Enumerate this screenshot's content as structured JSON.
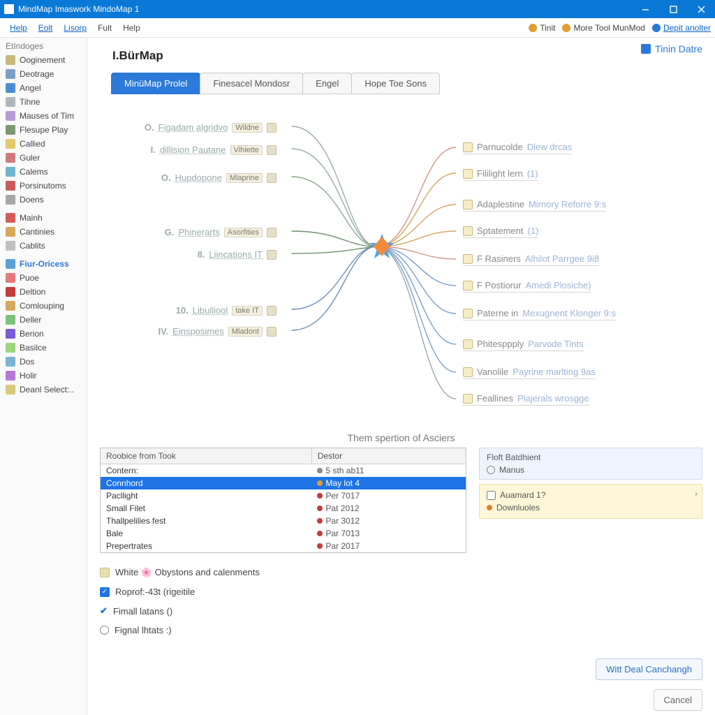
{
  "window": {
    "title": "MindMap Imaswork MindoMap 1"
  },
  "menu": {
    "left": [
      "Help",
      "Eolt",
      "Lisorp",
      "Fult",
      "Help"
    ],
    "right": [
      {
        "label": "Tinit",
        "link": false
      },
      {
        "label": "More Tool MunMod",
        "link": false
      },
      {
        "label": "Depit anolter",
        "link": true
      }
    ]
  },
  "sidebar": {
    "header": "EtIndoges",
    "groups": [
      {
        "items": [
          {
            "label": "Ooginement",
            "color": "#c9b97a"
          },
          {
            "label": "Deotrage",
            "color": "#7aa0c9"
          },
          {
            "label": "Angel",
            "color": "#4a8ed6"
          },
          {
            "label": "Tihne",
            "color": "#b0b6be"
          },
          {
            "label": "Mauses of Tim",
            "color": "#b89ad6"
          },
          {
            "label": "Flesupe Play",
            "color": "#7a9a6e"
          },
          {
            "label": "Callied",
            "color": "#e2c969"
          },
          {
            "label": "Guler",
            "color": "#d07a7a"
          },
          {
            "label": "Calems",
            "color": "#6fb5d0"
          },
          {
            "label": "Porsinutoms",
            "color": "#c95b5b"
          },
          {
            "label": "Doens",
            "color": "#a7a7a7"
          }
        ]
      },
      {
        "items": [
          {
            "label": "Mainh",
            "color": "#d65b5b"
          },
          {
            "label": "Cantinies",
            "color": "#d6a85b"
          },
          {
            "label": "Cablits",
            "color": "#bfbfbf"
          }
        ]
      },
      {
        "items": [
          {
            "label": "Fiur-Oricess",
            "color": "#5ba0d6",
            "header": true
          },
          {
            "label": "Puoe",
            "color": "#e47a7a"
          },
          {
            "label": "Deltion",
            "color": "#c43b3b"
          },
          {
            "label": "Comlouping",
            "color": "#d6a85b"
          },
          {
            "label": "Deller",
            "color": "#7ac47a"
          },
          {
            "label": "Berion",
            "color": "#7a5bd6"
          },
          {
            "label": "Basilce",
            "color": "#9ad67a"
          },
          {
            "label": "Dos",
            "color": "#7ab5d6"
          },
          {
            "label": "Holir",
            "color": "#b57ad6"
          },
          {
            "label": "Deanl Select:..",
            "color": "#d6c97a"
          }
        ]
      }
    ]
  },
  "page": {
    "title": "I.BürMap",
    "badge": "Tinin Datre",
    "tabs": [
      "MinüMap Prolel",
      "Finesacel Mondosr",
      "Engel",
      "Hope Toe Sons"
    ],
    "caption": "Them spertion of Asciers"
  },
  "mindmap": {
    "left": [
      {
        "num": "O.",
        "label": "Figadam algridvo",
        "tag": "Wildne"
      },
      {
        "num": "I.",
        "label": "dillision Pautane",
        "tag": "Vihiette"
      },
      {
        "num": "O.",
        "label": "Hupdopone",
        "tag": "Mlaprine"
      },
      {
        "num": "G.",
        "label": "Phinerarts",
        "tag": "Asorfities"
      },
      {
        "num": "8.",
        "label": "Liincations IT",
        "tag": ""
      },
      {
        "num": "10.",
        "label": "Libulliool",
        "tag": "take IT"
      },
      {
        "num": "IV.",
        "label": "Einsposimes",
        "tag": "Mladont"
      }
    ],
    "right": [
      {
        "label": "Parnucolde",
        "ext": "Dlew drcas"
      },
      {
        "label": "Fililight lern",
        "ext": "(1)"
      },
      {
        "label": "Adaplestine",
        "ext": "Mirnory Reforre 9:s"
      },
      {
        "label": "Sptatement",
        "ext": "(1)"
      },
      {
        "label": "F Rasiners",
        "ext": "Alhilot Parrgee 9i8"
      },
      {
        "label": "F Postiorur",
        "ext": "Amedi Plosiche)"
      },
      {
        "label": "Paterne in",
        "ext": "Mexugnent Klonger 9:s"
      },
      {
        "label": "Phitesppply",
        "ext": "Parvode Tints"
      },
      {
        "label": "Vanolile",
        "ext": "Payrine marlting 9as"
      },
      {
        "label": "Feallines",
        "ext": "Plajerals wrosgge"
      }
    ]
  },
  "table": {
    "columns": [
      "Roobice from Took",
      "Destor"
    ],
    "rows": [
      {
        "name": "Contern:",
        "dest": "5 sth ab11",
        "dot": "#888"
      },
      {
        "name": "Connhord",
        "dest": "May lot 4",
        "dot": "#e0a030",
        "selected": true
      },
      {
        "name": "Pacllight",
        "dest": "Per 7017",
        "dot": "#c43b3b"
      },
      {
        "name": "Small Filet",
        "dest": "Pat 2012",
        "dot": "#c43b3b"
      },
      {
        "name": "Thallpelilies fest",
        "dest": "Par 3012",
        "dot": "#c43b3b"
      },
      {
        "name": "Bale",
        "dest": "Par 7013",
        "dot": "#c43b3b"
      },
      {
        "name": "Prepertrates",
        "dest": "Par 2017",
        "dot": "#c43b3b"
      }
    ]
  },
  "sidepanel": {
    "box1": {
      "header": "Floft Batdhient",
      "radio": "Manus"
    },
    "box2": {
      "row1": "Auamard 1?",
      "row2": "Downluoles"
    }
  },
  "options": [
    {
      "type": "icon-check",
      "label": "White 🌸 Obystons and calenments"
    },
    {
      "type": "checkbox",
      "checked": true,
      "label": "Roprof:-43t (rigeitile"
    },
    {
      "type": "check-blue",
      "checked": true,
      "label": "Fimall latans ()"
    },
    {
      "type": "radio",
      "label": "Fignal lhtats :)"
    }
  ],
  "buttons": {
    "primary": "Witt Deal Canchangh",
    "cancel": "Cancel"
  }
}
